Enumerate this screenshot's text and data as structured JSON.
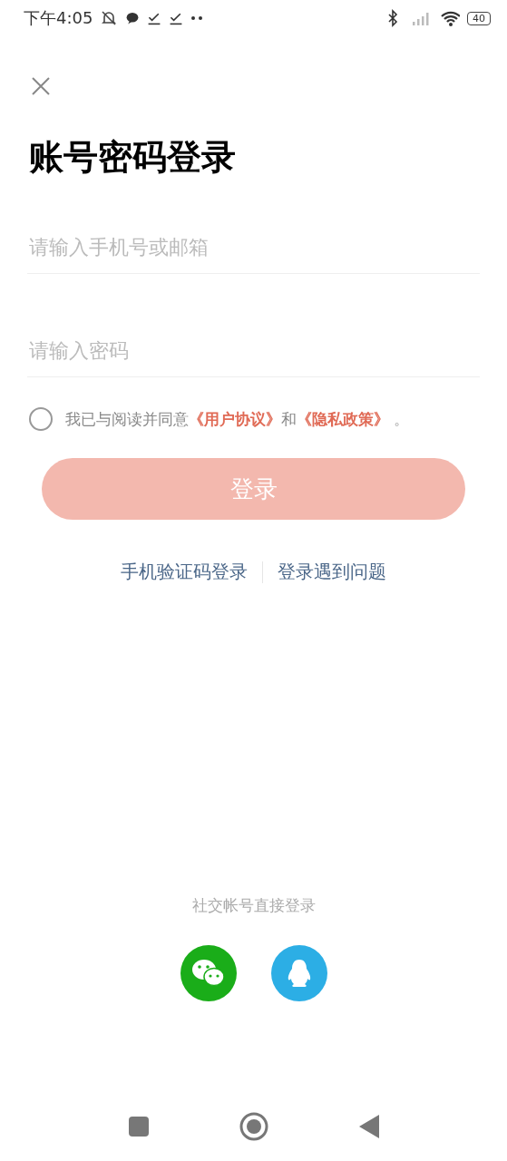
{
  "status_bar": {
    "time": "下午4:05",
    "battery": "40"
  },
  "title": "账号密码登录",
  "fields": [
    {
      "placeholder": "请输入手机号或邮箱"
    },
    {
      "placeholder": "请输入密码"
    }
  ],
  "agreement": {
    "checked": false,
    "parts": [
      {
        "kind": "text",
        "text": "我已与阅读并同意"
      },
      {
        "kind": "link",
        "text": "《用户协议》"
      },
      {
        "kind": "text",
        "text": "和"
      },
      {
        "kind": "link",
        "text": "《隐私政策》"
      },
      {
        "kind": "text",
        "text": " 。"
      }
    ]
  },
  "login_button": {
    "label": "登录",
    "disabled": true
  },
  "links": [
    "手机验证码登录",
    "登录遇到问题"
  ],
  "social": {
    "label": "社交帐号直接登录",
    "buttons": [
      {
        "kind": "wechat",
        "color": "#1aad19"
      },
      {
        "kind": "qq",
        "color": "#2caee5"
      }
    ]
  }
}
